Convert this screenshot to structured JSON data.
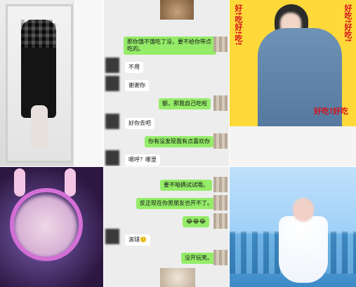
{
  "chat_top": {
    "messages": [
      {
        "side": "me",
        "text": "那你饿不饿吃了没，要不给你带点吃的。"
      },
      {
        "side": "other",
        "text": "不用"
      },
      {
        "side": "other",
        "text": "谢谢你"
      },
      {
        "side": "me",
        "text": "额，那我自己吃啦"
      },
      {
        "side": "other",
        "text": "好你去吧"
      },
      {
        "side": "me",
        "text": "你有没发现我有点喜欢你"
      },
      {
        "side": "other",
        "text": "嗯呼？哪里"
      }
    ]
  },
  "chat_bottom": {
    "messages": [
      {
        "side": "me",
        "text": "要不咱俩试试哦。"
      },
      {
        "side": "me",
        "text": "反正现在你男朋友也开不了。"
      },
      {
        "side": "me",
        "text": "😂😂😂"
      },
      {
        "side": "other",
        "text": "滚球🙂"
      },
      {
        "side": "me",
        "text": "没开玩笑。"
      }
    ]
  },
  "stickers": {
    "left_column": "好!吃好!吃!",
    "right_column": "好吃!好吃!",
    "bottom": "好吃!好吃"
  }
}
